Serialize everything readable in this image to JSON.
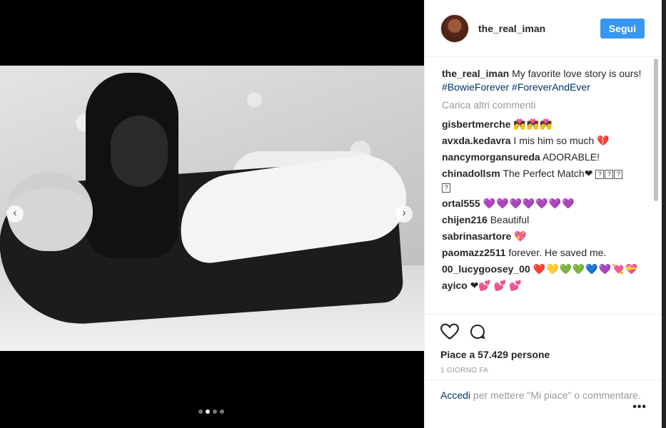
{
  "media": {
    "prev_glyph": "‹",
    "next_glyph": "›",
    "dots_count": 4,
    "active_dot": 1
  },
  "header": {
    "username": "the_real_iman",
    "follow_label": "Segui"
  },
  "caption": {
    "username": "the_real_iman",
    "text": "My favorite love story is ours!",
    "tags": [
      "#BowieForever",
      "#ForeverAndEver"
    ]
  },
  "load_more_label": "Carica altri commenti",
  "comments": [
    {
      "user": "gisbertmerche",
      "text": "💏💏💏"
    },
    {
      "user": "avxda.kedavra",
      "text": "I mis him so much 💔"
    },
    {
      "user": "nancymorgansureda",
      "text": "ADORABLE!"
    },
    {
      "user": "chinadollsm",
      "text": "The Perfect Match❤"
    },
    {
      "user": "ortal555",
      "text": "💜💜💜💜💜💜💜"
    },
    {
      "user": "chijen216",
      "text": "Beautiful"
    },
    {
      "user": "sabrinasartore",
      "text": "💖"
    },
    {
      "user": "paomazz2511",
      "text": "forever. He saved me."
    },
    {
      "user": "00_lucygoosey_00",
      "text": "❤️💛💚💚💙💜💘💝"
    },
    {
      "user": "ayico",
      "text": "❤💕 💕 💕"
    }
  ],
  "actions": {
    "likes_text": "Piace a 57.429 persone",
    "time_text": "1 GIORNO FA"
  },
  "add_comment": {
    "login_label": "Accedi",
    "rest_text": "per mettere \"Mi piace\" o commentare.",
    "more_label": "•••"
  },
  "colors": {
    "accent": "#3897f0",
    "link": "#003569",
    "muted": "#999999",
    "text": "#262626"
  }
}
